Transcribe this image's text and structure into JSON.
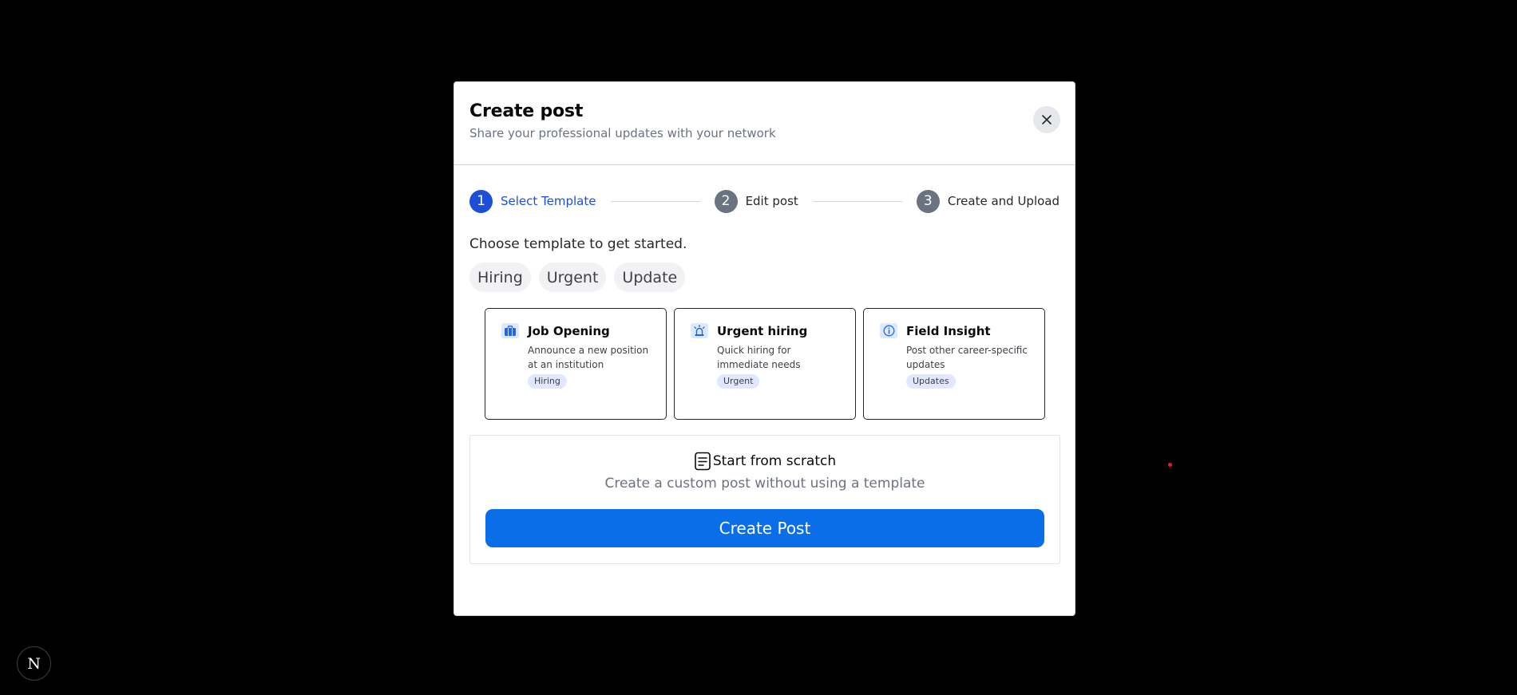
{
  "modal": {
    "title": "Create post",
    "subtitle": "Share your professional updates with your network"
  },
  "stepper": [
    {
      "number": "1",
      "label": "Select Template",
      "state": "active"
    },
    {
      "number": "2",
      "label": "Edit post",
      "state": "inactive"
    },
    {
      "number": "3",
      "label": "Create and Upload",
      "state": "inactive"
    }
  ],
  "choose_label": "Choose template to get started.",
  "filters": [
    "Hiring",
    "Urgent",
    "Update"
  ],
  "templates": [
    {
      "icon": "briefcase-icon",
      "title": "Job Opening",
      "description": "Announce a new position at an institution",
      "tag": "Hiring"
    },
    {
      "icon": "siren-icon",
      "title": "Urgent hiring",
      "description": "Quick hiring for immediate needs",
      "tag": "Urgent"
    },
    {
      "icon": "info-icon",
      "title": "Field Insight",
      "description": "Post other career-specific updates",
      "tag": "Updates"
    }
  ],
  "scratch": {
    "icon": "document-icon",
    "title": "Start from scratch",
    "description": "Create a custom post without using a template",
    "button_label": "Create Post"
  },
  "badge": {
    "label": "N"
  },
  "colors": {
    "accent": "#1d4ed8",
    "primary_button": "#0a6ee8",
    "background": "#000000"
  }
}
